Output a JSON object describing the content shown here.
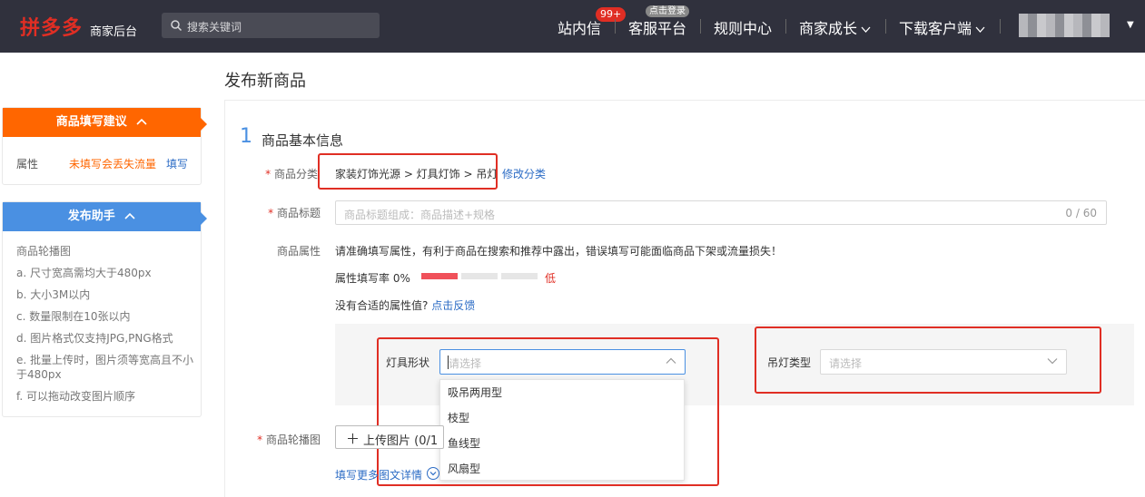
{
  "header": {
    "logo": "拼多多",
    "logo_sub": "商家后台",
    "search_placeholder": "搜索关键词",
    "nav": {
      "messages": "站内信",
      "messages_badge": "99+",
      "customer_service": "客服平台",
      "customer_service_badge": "点击登录",
      "rules": "规则中心",
      "growth": "商家成长",
      "download": "下载客户端"
    }
  },
  "sidebar": {
    "suggest": {
      "title": "商品填写建议",
      "row_key": "属性",
      "row_value": "未填写会丢失流量",
      "row_action": "填写"
    },
    "helper": {
      "title": "发布助手",
      "items": [
        "商品轮播图",
        "a. 尺寸宽高需均大于480px",
        "b. 大小3M以内",
        "c. 数量限制在10张以内",
        "d. 图片格式仅支持JPG,PNG格式",
        "e. 批量上传时，图片须等宽高且不小于480px",
        "f. 可以拖动改变图片顺序"
      ]
    }
  },
  "main": {
    "page_title": "发布新商品",
    "section_number": "1",
    "section_title": "商品基本信息",
    "category": {
      "label": "商品分类",
      "path": "家装灯饰光源 > 灯具灯饰 > 吊灯",
      "edit": "修改分类"
    },
    "title_field": {
      "label": "商品标题",
      "placeholder": "商品标题组成：商品描述+规格",
      "counter": "0 / 60"
    },
    "attributes": {
      "label": "商品属性",
      "tip": "请准确填写属性，有利于商品在搜索和推荐中露出，错误填写可能面临商品下架或流量损失！",
      "fill_rate_label": "属性填写率 0%",
      "fill_rate": 0.33,
      "fill_level": "低",
      "no_fit_text": "没有合适的属性值?",
      "no_fit_link": "点击反馈",
      "lamp_shape": {
        "label": "灯具形状",
        "placeholder": "请选择",
        "options": [
          "吸吊两用型",
          "枝型",
          "鱼线型",
          "风扇型"
        ]
      },
      "chandelier_type": {
        "label": "吊灯类型",
        "placeholder": "请选择"
      }
    },
    "carousel": {
      "label": "商品轮播图",
      "upload_button": "上传图片 (0/1",
      "more_link": "填写更多图文详情"
    }
  },
  "colors": {
    "header_bg": "#30313d",
    "brand_red": "#e02e24",
    "suggest_orange": "#ff6600",
    "helper_blue": "#4a90e2",
    "link_blue": "#2c6cc5"
  }
}
